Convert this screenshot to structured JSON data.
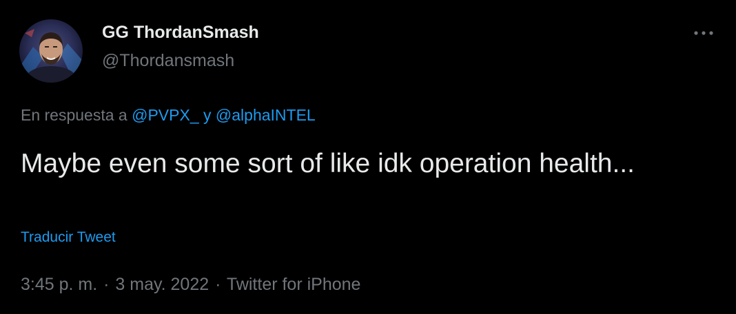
{
  "author": {
    "display_name": "GG ThordanSmash",
    "handle": "@Thordansmash",
    "avatar_icon": "user-avatar-photo"
  },
  "menu": {
    "icon": "more-horizontal-icon",
    "glyph": "···"
  },
  "reply_to": {
    "prefix": "En respuesta a",
    "mentions": [
      "@PVPX_",
      "@alphaINTEL"
    ],
    "joiner": "y"
  },
  "tweet": {
    "text": "Maybe even some sort of like idk operation health...",
    "translate_label": "Traducir Tweet"
  },
  "meta": {
    "time": "3:45 p. m.",
    "date": "3 may. 2022",
    "source": "Twitter for iPhone",
    "separator": "·"
  },
  "colors": {
    "background": "#000000",
    "primary_text": "#e7e9ea",
    "secondary_text": "#71767b",
    "link": "#1d9bf0"
  }
}
